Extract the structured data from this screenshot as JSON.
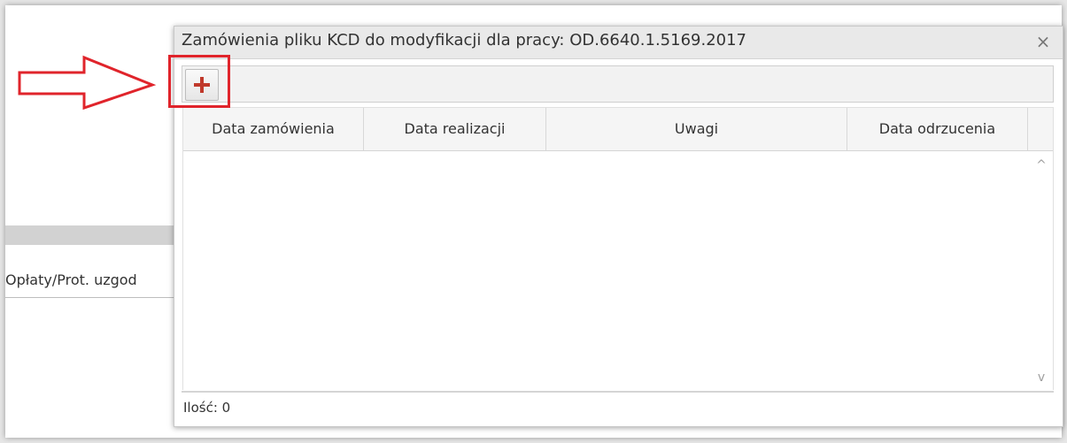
{
  "background": {
    "tab_label": "Opłaty/Prot. uzgod"
  },
  "dialog": {
    "title": "Zamówienia pliku KCD do modyfikacji dla pracy: OD.6640.1.5169.2017",
    "close_symbol": "×",
    "toolbar": {
      "add_button_icon": "plus-icon"
    },
    "grid": {
      "columns": [
        "Data zamówienia",
        "Data realizacji",
        "Uwagi",
        "Data odrzucenia",
        ""
      ],
      "rows": []
    },
    "scrollbar": {
      "up_symbol": "^",
      "down_symbol": "v"
    },
    "footer": {
      "count_label": "Ilość: 0"
    }
  },
  "annotation": {
    "color": "#e0242b"
  }
}
